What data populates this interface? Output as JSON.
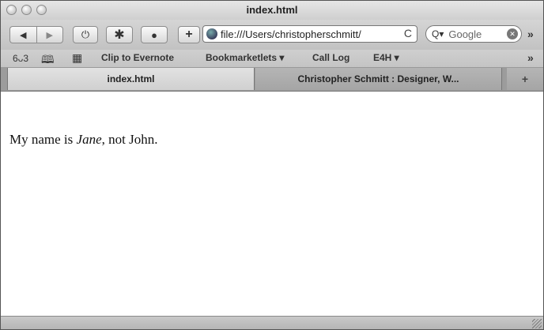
{
  "window": {
    "title": "index.html"
  },
  "toolbar": {
    "back_icon": "◀",
    "forward_icon": "▶",
    "history_icon": "⏻",
    "bug_icon": "✱",
    "stop_icon": "●",
    "add_bookmark_icon": "+",
    "address": "file:///Users/christopherschmitt/",
    "reload_icon": "C",
    "search_icon": "Q▾",
    "search_placeholder": "Google",
    "search_clear_icon": "✕",
    "overflow": "»"
  },
  "bookmarks": {
    "reading_glasses_icon": "6ᴗ3",
    "book_icon": "🕮",
    "grid_icon": "▦",
    "items": [
      "Clip to Evernote",
      "Bookmarketlets ▾",
      "Call Log",
      "E4H ▾"
    ],
    "overflow": "»"
  },
  "tabs": [
    {
      "label": "index.html",
      "active": true
    },
    {
      "label": "Christopher Schmitt : Designer, W...",
      "active": false
    }
  ],
  "new_tab_label": "+",
  "content": {
    "before": "My name is ",
    "emphasis": "Jane",
    "after": ", not John."
  }
}
